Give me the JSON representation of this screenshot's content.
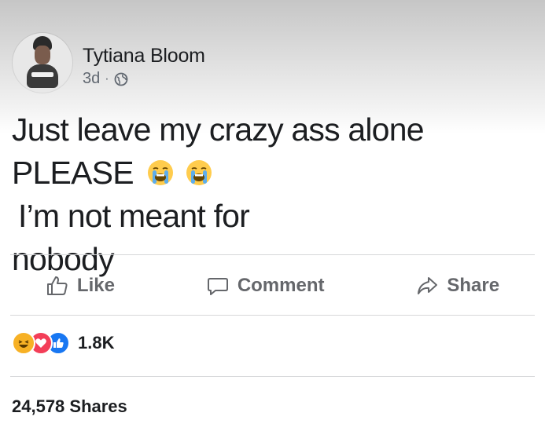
{
  "post": {
    "author": "Tytiana Bloom",
    "time": "3d",
    "separator": "·",
    "visibility_icon": "globe-icon",
    "text_line1": "Just leave my crazy ass alone",
    "text_line2_start": "PLEASE",
    "text_line2_end": "I’m not meant for",
    "text_line3": "nobody",
    "emojis": [
      "loudly-crying-face-icon",
      "loudly-crying-face-icon"
    ]
  },
  "actions": {
    "like_label": "Like",
    "comment_label": "Comment",
    "share_label": "Share"
  },
  "reactions": {
    "icons": [
      "haha-reaction-icon",
      "love-reaction-icon",
      "like-reaction-icon"
    ],
    "count": "1.8K"
  },
  "shares": {
    "label": "24,578 Shares"
  },
  "colors": {
    "text": "#1c1e21",
    "muted": "#65676b",
    "like_blue": "#1877f2",
    "love_red": "#f33e58",
    "haha_yellow": "#f7b125"
  }
}
